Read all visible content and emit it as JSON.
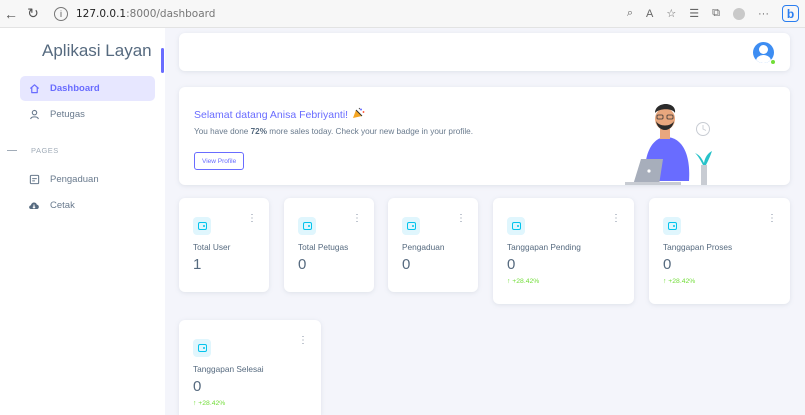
{
  "browser": {
    "url_host": "127.0.0.1",
    "url_path": ":8000/dashboard"
  },
  "sidebar": {
    "brand": "Aplikasi Layan",
    "items": [
      {
        "label": "Dashboard",
        "icon": "home-icon",
        "active": true
      },
      {
        "label": "Petugas",
        "icon": "user-icon",
        "active": false
      }
    ],
    "section_label": "PAGES",
    "page_items": [
      {
        "label": "Pengaduan",
        "icon": "report-icon"
      },
      {
        "label": "Cetak",
        "icon": "cloud-download-icon"
      }
    ]
  },
  "welcome": {
    "title": "Selamat datang Anisa Febriyanti!",
    "text_before": "You have done ",
    "percent": "72%",
    "text_after": " more sales today. Check your new badge in your profile.",
    "button": "View Profile"
  },
  "stats": [
    {
      "label": "Total User",
      "value": "1",
      "trend": ""
    },
    {
      "label": "Total Petugas",
      "value": "0",
      "trend": ""
    },
    {
      "label": "Pengaduan",
      "value": "0",
      "trend": ""
    },
    {
      "label": "Tanggapan Pending",
      "value": "0",
      "trend": "↑ +28.42%"
    },
    {
      "label": "Tanggapan Proses",
      "value": "0",
      "trend": "↑ +28.42%"
    },
    {
      "label": "Tanggapan Selesai",
      "value": "0",
      "trend": "↑ +28.42%"
    }
  ],
  "colors": {
    "accent": "#696cff",
    "info": "#03c3ec",
    "success": "#71dd37",
    "background": "#f4f5fb"
  }
}
